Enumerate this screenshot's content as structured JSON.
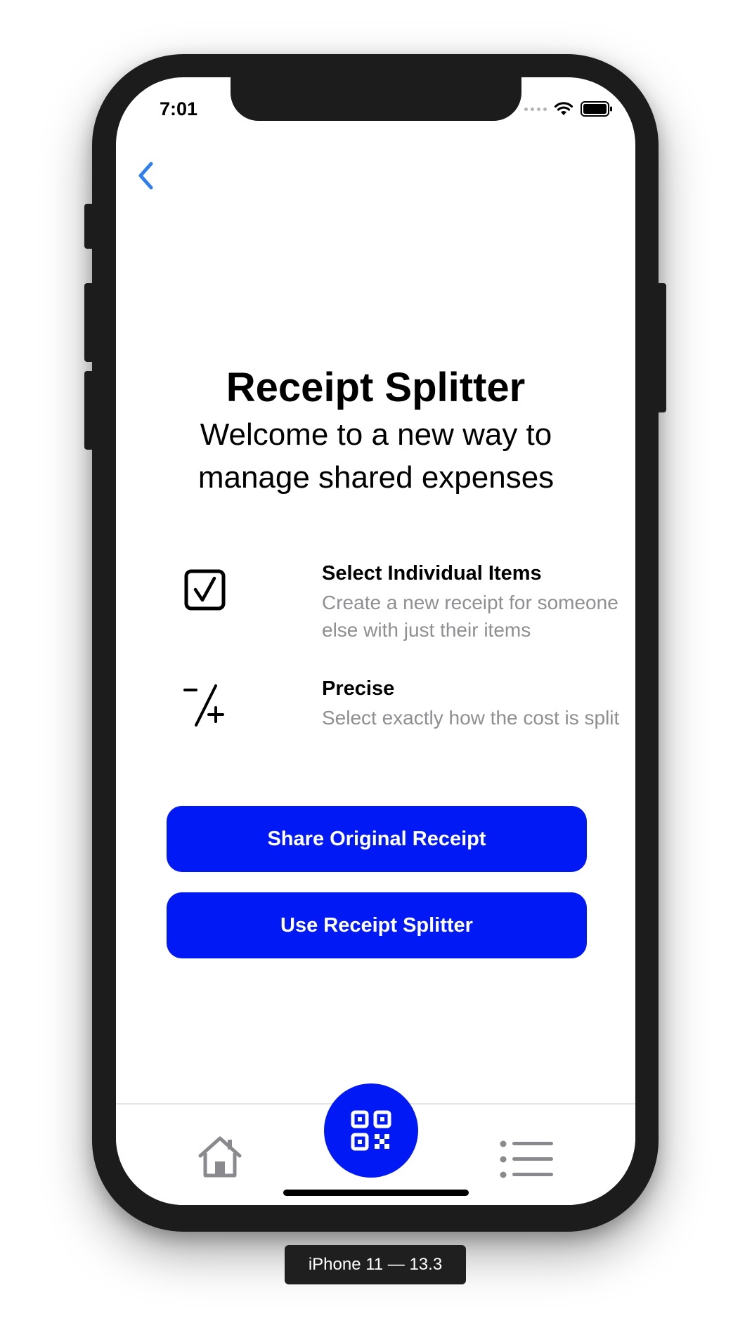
{
  "status_bar": {
    "time": "7:01"
  },
  "nav": {
    "back_icon": "chevron-left-icon"
  },
  "header": {
    "title": "Receipt Splitter",
    "subtitle": "Welcome to a new way to manage shared expenses"
  },
  "features": [
    {
      "icon": "checkbox-icon",
      "title": "Select Individual Items",
      "description": "Create a new receipt for someone else with just their items"
    },
    {
      "icon": "plus-minus-icon",
      "title": "Precise",
      "description": "Select exactly how the cost is split"
    }
  ],
  "actions": {
    "share_label": "Share Original Receipt",
    "split_label": "Use Receipt Splitter"
  },
  "tab_bar": {
    "items": [
      "home-icon",
      "qr-code-icon",
      "list-icon"
    ]
  },
  "device_label": "iPhone 11 — 13.3",
  "colors": {
    "accent": "#0019f5",
    "back_chevron": "#2f7ff0",
    "secondary_text": "#8e8e93",
    "device_frame": "#1c1c1c"
  }
}
